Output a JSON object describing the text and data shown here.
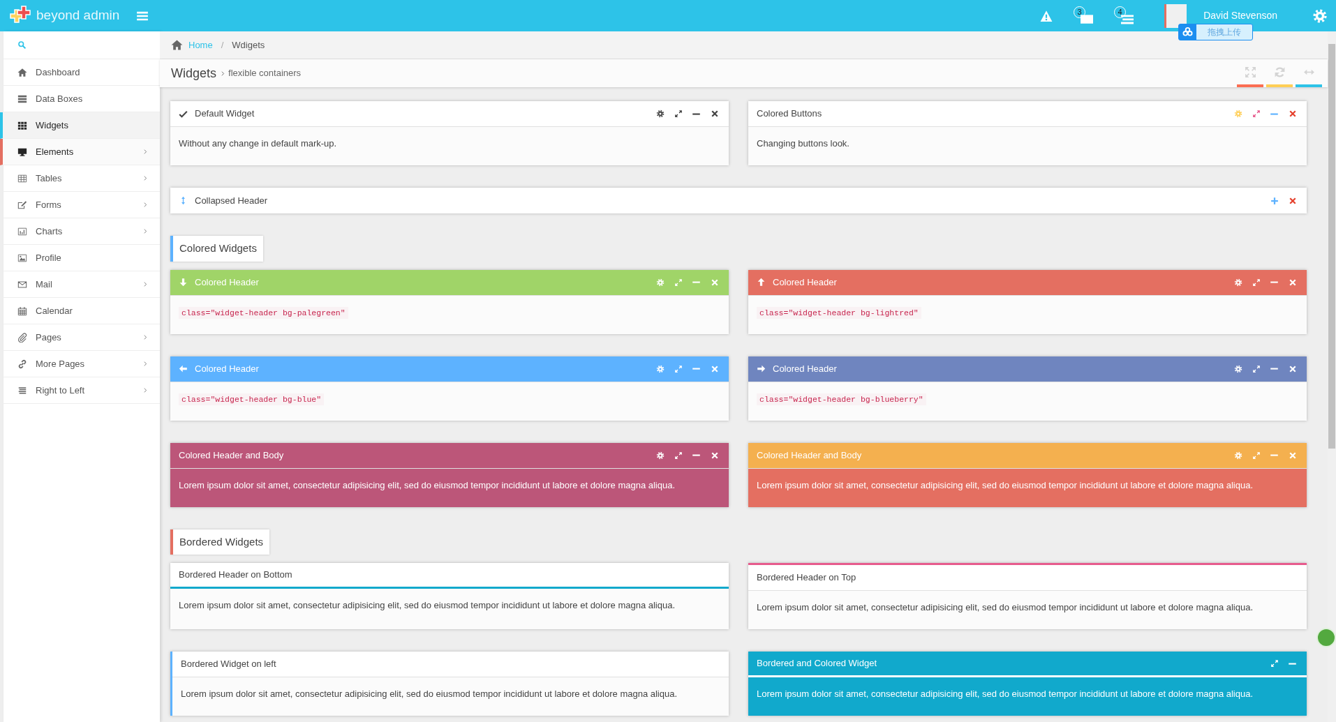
{
  "topbar": {
    "logo": "beyond admin",
    "message_count": "3",
    "task_count": "4",
    "user": "David Stevenson",
    "upload_tooltip": "拖拽上传"
  },
  "sidebar": {
    "items": [
      {
        "label": "Dashboard",
        "selected": false,
        "open": false,
        "submenu": false
      },
      {
        "label": "Data Boxes",
        "selected": false,
        "open": false,
        "submenu": false
      },
      {
        "label": "Widgets",
        "selected": true,
        "open": false,
        "submenu": false
      },
      {
        "label": "Elements",
        "selected": false,
        "open": true,
        "submenu": true
      },
      {
        "label": "Tables",
        "selected": false,
        "open": false,
        "submenu": true
      },
      {
        "label": "Forms",
        "selected": false,
        "open": false,
        "submenu": true
      },
      {
        "label": "Charts",
        "selected": false,
        "open": false,
        "submenu": true
      },
      {
        "label": "Profile",
        "selected": false,
        "open": false,
        "submenu": false
      },
      {
        "label": "Mail",
        "selected": false,
        "open": false,
        "submenu": true
      },
      {
        "label": "Calendar",
        "selected": false,
        "open": false,
        "submenu": false
      },
      {
        "label": "Pages",
        "selected": false,
        "open": false,
        "submenu": true
      },
      {
        "label": "More Pages",
        "selected": false,
        "open": false,
        "submenu": true
      },
      {
        "label": "Right to Left",
        "selected": false,
        "open": false,
        "submenu": true
      }
    ]
  },
  "breadcrumb": {
    "separator": "/",
    "items": [
      {
        "label": "Home",
        "link": true
      },
      {
        "label": "Wdigets",
        "link": false
      }
    ]
  },
  "page_header": {
    "title": "Widgets",
    "subtitle": "flexible containers",
    "buttons": [
      {
        "color": "#fb6e52"
      },
      {
        "color": "#ffce55"
      },
      {
        "color": "#2dc3e8"
      }
    ]
  },
  "sections": [
    {
      "widgets": [
        {
          "kind": "default",
          "title": "Default Widget",
          "body": "Without any change in default mark-up."
        },
        {
          "kind": "colored-buttons",
          "title": "Colored Buttons",
          "body": "Changing buttons look."
        },
        {
          "kind": "collapsed",
          "title": "Collapsed Header"
        }
      ]
    },
    {
      "title": "Colored Widgets",
      "color": "#5db2ff",
      "widgets": [
        {
          "kind": "colored-header",
          "title": "Colored Header",
          "color": "#a0d468",
          "code": "class=\"widget-header bg-palegreen\""
        },
        {
          "kind": "colored-header",
          "title": "Colored Header",
          "color": "#e46f61",
          "code": "class=\"widget-header bg-lightred\""
        },
        {
          "kind": "colored-header",
          "title": "Colored Header",
          "color": "#5db2ff",
          "code": "class=\"widget-header bg-blue\""
        },
        {
          "kind": "colored-header",
          "title": "Colored Header",
          "color": "#6f85bf",
          "code": "class=\"widget-header bg-blueberry\""
        },
        {
          "kind": "colored-body",
          "title": "Colored Header and Body",
          "color": "#bc5679",
          "body_fill": {
            "color": "#bc5679"
          },
          "body": "Lorem ipsum dolor sit amet, consectetur adipisicing elit, sed do eiusmod tempor incididunt ut labore et dolore magna aliqua."
        },
        {
          "kind": "colored-body",
          "title": "Colored Header and Body",
          "color": "#f4b04f",
          "body_fill": {
            "color": "#e46f61"
          },
          "body": "Lorem ipsum dolor sit amet, consectetur adipisicing elit, sed do eiusmod tempor incididunt ut labore et dolore magna aliqua."
        }
      ]
    },
    {
      "title": "Bordered Widgets",
      "color": "#e46f61",
      "widgets": [
        {
          "kind": "bordered-bottom",
          "title": "Bordered Header on Bottom",
          "border": {
            "color": "#11a9cc"
          },
          "body": "Lorem ipsum dolor sit amet, consectetur adipisicing elit, sed do eiusmod tempor incididunt ut labore et dolore magna aliqua."
        },
        {
          "kind": "bordered-top",
          "title": "Bordered Header on Top",
          "border": {
            "color": "#e75b8d"
          },
          "body": "Lorem ipsum dolor sit amet, consectetur adipisicing elit, sed do eiusmod tempor incididunt ut labore et dolore magna aliqua."
        },
        {
          "kind": "bordered-left",
          "title": "Bordered Widget on left",
          "border": {
            "color": "#5db2ff"
          },
          "body": "Lorem ipsum dolor sit amet, consectetur adipisicing elit, sed do eiusmod tempor incididunt ut labore et dolore magna aliqua."
        },
        {
          "kind": "bordered-colored",
          "title": "Bordered and Colored Widget",
          "color": "#11a9cc",
          "body_fill": {
            "color": "#11a9cc"
          },
          "border": {
            "color": "#ffffff"
          },
          "body": "Lorem ipsum dolor sit amet, consectetur adipisicing elit, sed do eiusmod tempor incididunt ut labore et dolore magna aliqua."
        }
      ]
    }
  ]
}
